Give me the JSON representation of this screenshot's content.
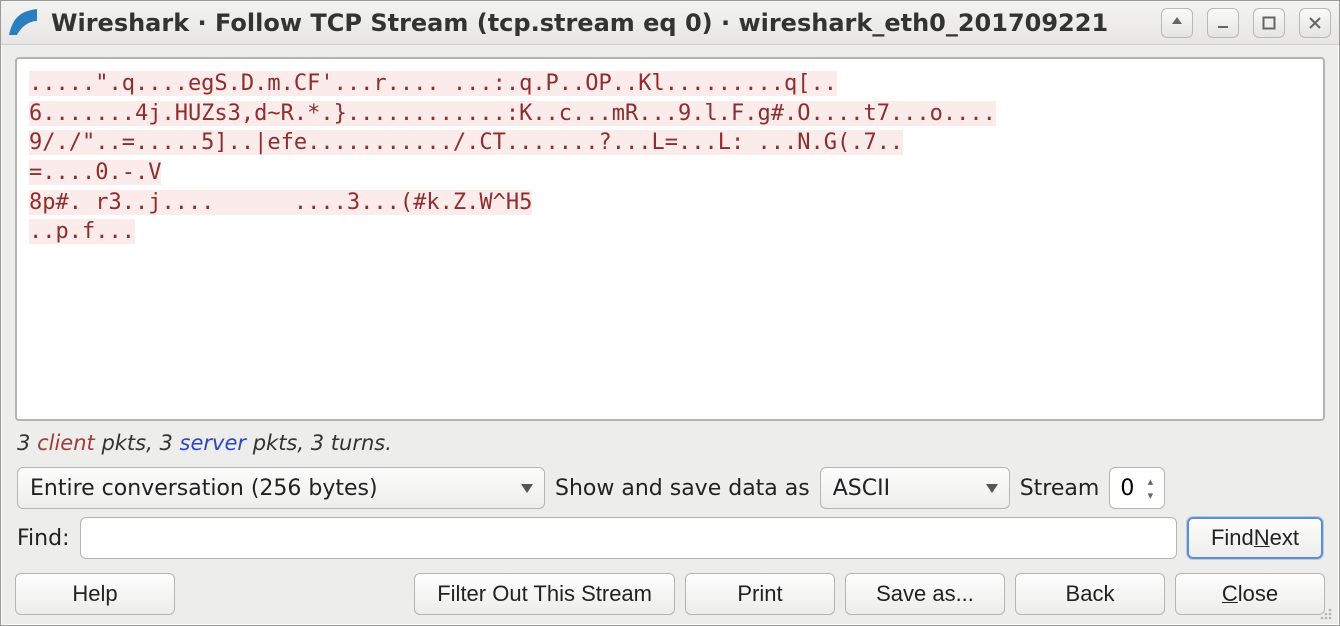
{
  "window": {
    "title": "Wireshark · Follow TCP Stream (tcp.stream eq 0) · wireshark_eth0_201709221"
  },
  "stream": {
    "lines": [
      ".....\".q....egS.D.m.CF'...r.... ...:.q.P..OP..Kl.........q[..",
      "6.......4j.HUZs3,d~R.*.}............:K..c...mR...9.l.F.g#.O....t7...o....",
      "9/./\"..=.....5]..|efe.........../.CT.......?...L=...L: ...N.G(.7..",
      "=....0.-.V",
      "8p#. r3..j....      ....3...(#k.Z.W^H5",
      "..p.f..."
    ]
  },
  "stats": {
    "client_pkts": "3",
    "client_label": "client",
    "pkts_word1": "pkts,",
    "server_pkts": "3",
    "server_label": "server",
    "pkts_word2": "pkts,",
    "turns": "3 turns."
  },
  "controls": {
    "conversation_selected": "Entire conversation (256 bytes)",
    "show_save_label": "Show and save data as",
    "format_selected": "ASCII",
    "stream_label": "Stream",
    "stream_value": "0"
  },
  "find": {
    "label": "Find:",
    "value": "",
    "placeholder": "",
    "find_next_pre": "Find ",
    "find_next_accel": "N",
    "find_next_post": "ext"
  },
  "buttons": {
    "help": "Help",
    "filter_out": "Filter Out This Stream",
    "print": "Print",
    "save_as": "Save as...",
    "back": "Back",
    "close_accel": "C",
    "close_post": "lose"
  }
}
